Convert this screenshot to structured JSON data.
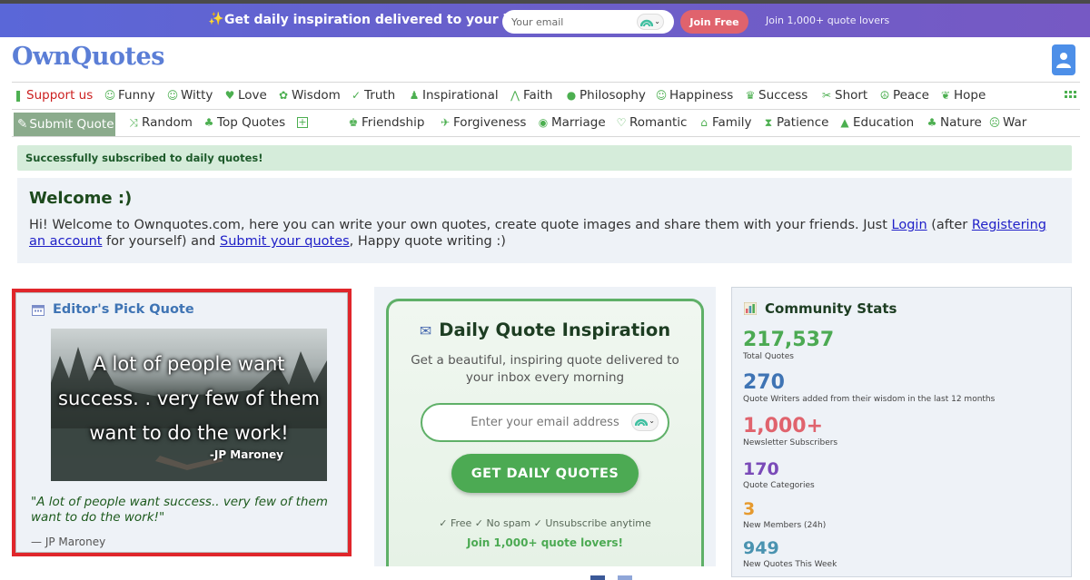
{
  "promo": {
    "headline": "Get daily inspiration delivered to your inbox",
    "email_placeholder": "Your email",
    "join_label": "Join Free",
    "joined_text": "Join 1,000+ quote lovers"
  },
  "header": {
    "logo": "OwnQuotes"
  },
  "nav_primary": [
    {
      "label": "Support us",
      "icon": "heart-flag-icon"
    },
    {
      "label": "Funny",
      "icon": "smile-icon"
    },
    {
      "label": "Witty",
      "icon": "smile-icon"
    },
    {
      "label": "Love",
      "icon": "heart-icon"
    },
    {
      "label": "Wisdom",
      "icon": "gear-icon"
    },
    {
      "label": "Truth",
      "icon": "check-icon"
    },
    {
      "label": "Inspirational",
      "icon": "person-icon"
    },
    {
      "label": "Faith",
      "icon": "praying-hands-icon"
    },
    {
      "label": "Philosophy",
      "icon": "lightbulb-icon"
    },
    {
      "label": "Happiness",
      "icon": "smile-icon"
    },
    {
      "label": "Success",
      "icon": "trophy-icon"
    },
    {
      "label": "Short",
      "icon": "scissors-icon"
    },
    {
      "label": "Peace",
      "icon": "peace-icon"
    },
    {
      "label": "Hope",
      "icon": "leaf-icon"
    }
  ],
  "nav_secondary": [
    {
      "label": "Submit Quote",
      "icon": "pencil-icon"
    },
    {
      "label": "Random",
      "icon": "shuffle-icon"
    },
    {
      "label": "Top Quotes",
      "icon": "thumbs-up-icon"
    },
    {
      "label": "Friendship",
      "icon": "users-icon"
    },
    {
      "label": "Forgiveness",
      "icon": "dove-icon"
    },
    {
      "label": "Marriage",
      "icon": "ring-icon"
    },
    {
      "label": "Romantic",
      "icon": "heart-icon"
    },
    {
      "label": "Family",
      "icon": "home-icon"
    },
    {
      "label": "Patience",
      "icon": "hourglass-icon"
    },
    {
      "label": "Education",
      "icon": "graduation-icon"
    },
    {
      "label": "Nature",
      "icon": "tree-icon"
    },
    {
      "label": "War",
      "icon": "skull-icon"
    }
  ],
  "alert": {
    "text": "Successfully subscribed to daily quotes!"
  },
  "welcome": {
    "title": "Welcome :)",
    "text_1": "Hi! Welcome to Ownquotes.com, here you can write your own quotes, create quote images and share them with your friends. Just ",
    "login_link": "Login",
    "text_2": " (after ",
    "register_link": "Registering an account",
    "text_3": " for yourself) and ",
    "submit_link": "Submit your quotes",
    "text_4": ", Happy quote writing :)"
  },
  "editors_pick": {
    "title": "Editor's Pick Quote",
    "image_quote": "A lot of people want success. . very few of them want to do the work!",
    "image_author": "-JP Maroney",
    "quote": "\"A lot of people want success.. very few of them want to do the work!\"",
    "author": "— JP Maroney"
  },
  "daily": {
    "title": "Daily Quote Inspiration",
    "subtitle": "Get a beautiful, inspiring quote delivered to your inbox every morning",
    "email_placeholder": "Enter your email address",
    "button": "GET DAILY QUOTES",
    "perks": "✓ Free ✓ No spam ✓ Unsubscribe anytime",
    "join": "Join 1,000+ quote lovers!"
  },
  "stats": {
    "title": "Community Stats",
    "items": [
      {
        "value": "217,537",
        "label": "Total Quotes",
        "color": "#4caa53"
      },
      {
        "value": "270",
        "label": "Quote Writers added from their wisdom in the last 12 months",
        "color": "#3f74b4"
      },
      {
        "value": "1,000+",
        "label": "Newsletter Subscribers",
        "color": "#e0636d"
      },
      {
        "value": "170",
        "label": "Quote Categories",
        "color": "#7a4ab8"
      },
      {
        "value": "3",
        "label": "New Members (24h)",
        "color": "#e69a2e"
      },
      {
        "value": "949",
        "label": "New Quotes This Week",
        "color": "#4a93b0"
      }
    ]
  }
}
